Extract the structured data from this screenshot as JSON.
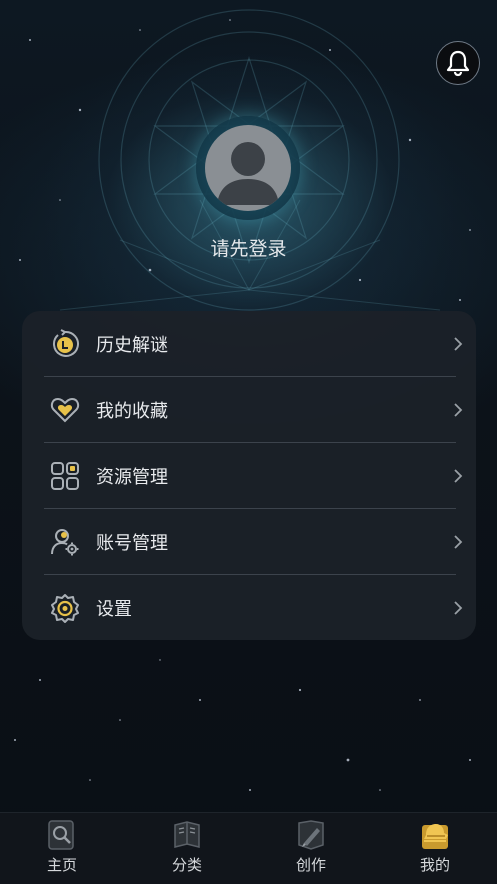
{
  "header": {
    "notification_icon": "bell-icon"
  },
  "profile": {
    "avatar_icon": "default-user-avatar",
    "login_prompt": "请先登录"
  },
  "menu": {
    "items": [
      {
        "label": "历史解谜",
        "icon": "history-clock-icon"
      },
      {
        "label": "我的收藏",
        "icon": "heart-icon"
      },
      {
        "label": "资源管理",
        "icon": "grid-apps-icon"
      },
      {
        "label": "账号管理",
        "icon": "user-gear-icon"
      },
      {
        "label": "设置",
        "icon": "gear-icon"
      }
    ],
    "chevron_icon": "chevron-right-icon"
  },
  "tabbar": {
    "tabs": [
      {
        "label": "主页",
        "icon": "magnifier-book-icon",
        "active": false
      },
      {
        "label": "分类",
        "icon": "book-icon",
        "active": false
      },
      {
        "label": "创作",
        "icon": "quill-pen-icon",
        "active": false
      },
      {
        "label": "我的",
        "icon": "detective-hat-icon",
        "active": true
      }
    ]
  },
  "colors": {
    "accent": "#e8c24a",
    "card_bg": "#1c2128",
    "text": "#e8eaed"
  }
}
